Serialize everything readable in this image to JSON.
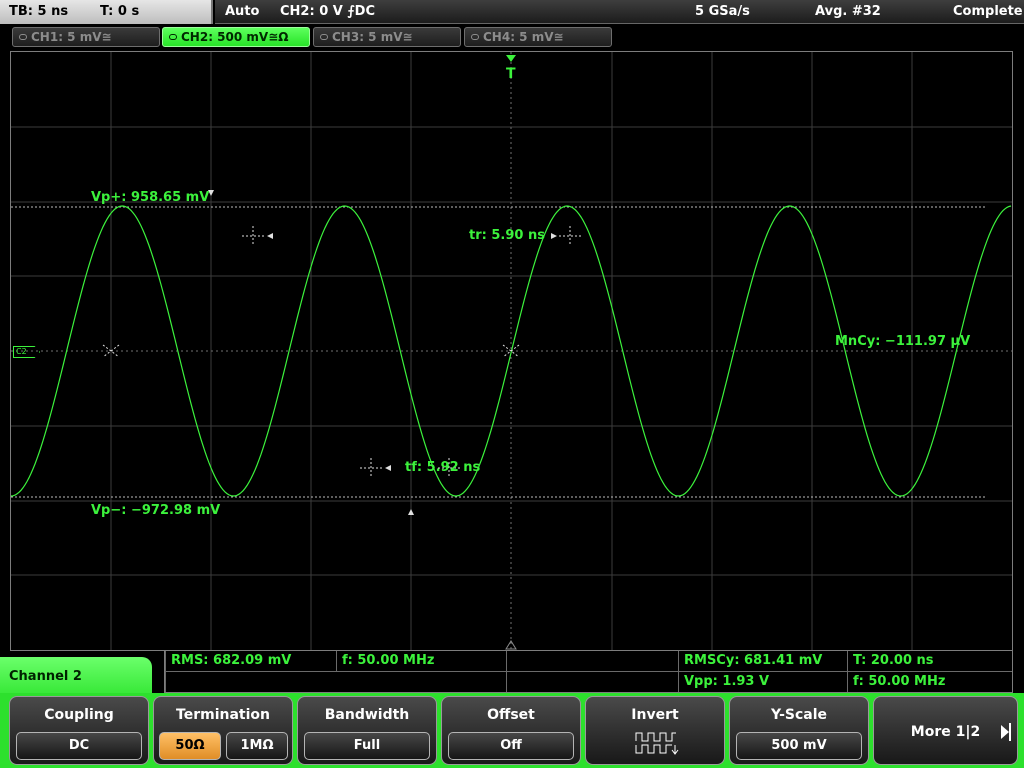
{
  "top_bar": {
    "timebase": "TB: 5 ns",
    "trigger_time": "T: 0 s",
    "trigger_mode": "Auto",
    "trigger_info": "CH2: 0 V ⨍DC",
    "sample_rate": "5 GSa/s",
    "acquisition": "Avg. #32",
    "status": "Complete"
  },
  "channel_tabs": [
    {
      "label": "CH1: 5 mV≅",
      "active": false
    },
    {
      "label": "CH2: 500 mV≅Ω",
      "active": true
    },
    {
      "label": "CH3: 5 mV≅",
      "active": false
    },
    {
      "label": "CH4: 5 mV≅",
      "active": false
    }
  ],
  "waveform": {
    "channel_marker": "C2",
    "trigger_marker": "T",
    "trace_color": "#3cf23c",
    "periods_shown": 4.5,
    "cursor_labels": {
      "vp_plus": "Vp+: 958.65 mV",
      "vp_minus": "Vp−: −972.98 mV",
      "rise_time": "tr: 5.90 ns",
      "fall_time": "tf: 5.92 ns",
      "mean_cycle": "MnCy: −111.97 µV"
    }
  },
  "measurements": {
    "rms": "RMS: 682.09 mV",
    "freq_1": "f: 50.00 MHz",
    "rms_cycle": "RMSCy: 681.41 mV",
    "period": "T: 20.00 ns",
    "vpp": "Vpp: 1.93 V",
    "freq_2": "f: 50.00 MHz"
  },
  "channel_menu": {
    "label": "Channel 2"
  },
  "softkeys": {
    "coupling": {
      "title": "Coupling",
      "value": "DC"
    },
    "termination": {
      "title": "Termination",
      "option_selected": "50Ω",
      "option_other": "1MΩ"
    },
    "bandwidth": {
      "title": "Bandwidth",
      "value": "Full"
    },
    "offset": {
      "title": "Offset",
      "value": "Off"
    },
    "invert": {
      "title": "Invert"
    },
    "y_scale": {
      "title": "Y-Scale",
      "value": "500 mV"
    },
    "more": {
      "title": "More 1|2"
    }
  },
  "colors": {
    "channel_green": "#3cf23c",
    "softkey_bar": "#2de02d",
    "selected_option": "#f0a040"
  }
}
